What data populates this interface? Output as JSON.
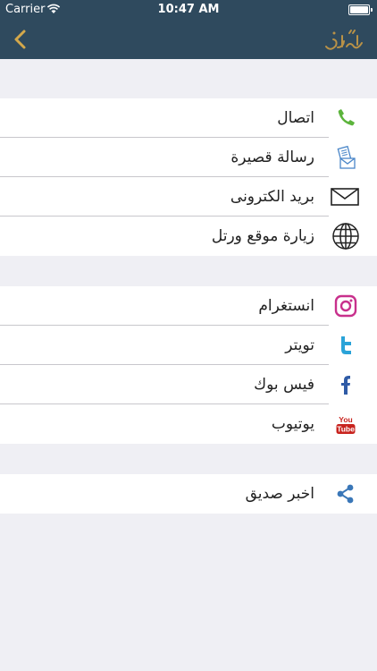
{
  "status_bar": {
    "carrier": "Carrier",
    "time": "10:47 AM"
  },
  "colors": {
    "navbar": "#2f4a5e",
    "back_arrow": "#d4a84b",
    "background": "#efeff4"
  },
  "navbar": {
    "back_icon": "chevron-left-icon",
    "logo_icon": "warattil-logo-icon"
  },
  "groups": [
    {
      "items": [
        {
          "label": "اتصال",
          "icon": "phone-icon"
        },
        {
          "label": "رسالة قصيرة",
          "icon": "sms-icon"
        },
        {
          "label": "بريد الكترونى",
          "icon": "envelope-icon"
        },
        {
          "label": "زيارة موقع ورتل",
          "icon": "globe-icon"
        }
      ]
    },
    {
      "items": [
        {
          "label": "انستغرام",
          "icon": "instagram-icon"
        },
        {
          "label": "تويتر",
          "icon": "twitter-icon"
        },
        {
          "label": "فيس بوك",
          "icon": "facebook-icon"
        },
        {
          "label": "يوتيوب",
          "icon": "youtube-icon"
        }
      ]
    },
    {
      "items": [
        {
          "label": "اخبر صديق",
          "icon": "share-icon"
        }
      ]
    }
  ]
}
